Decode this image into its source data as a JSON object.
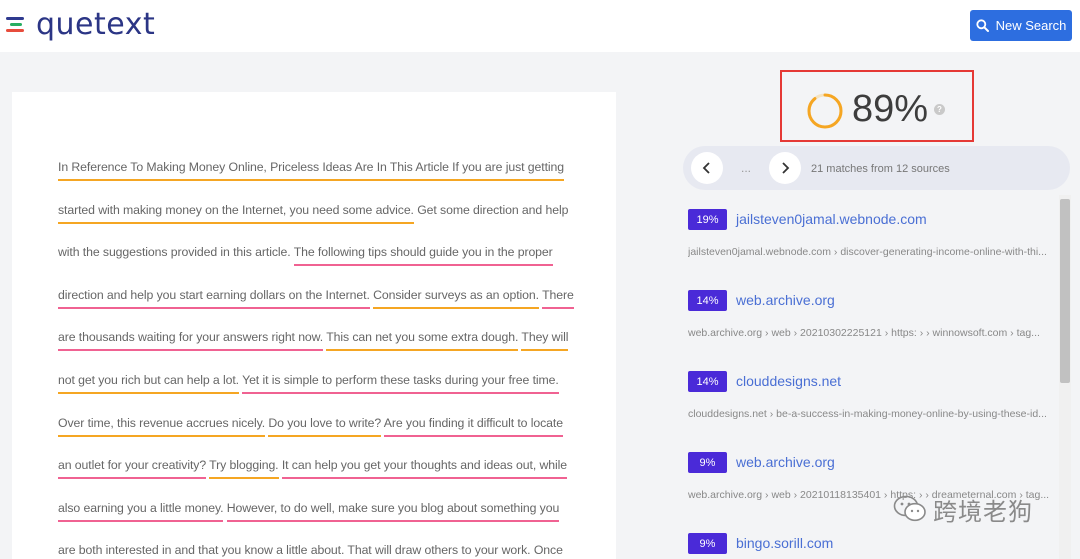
{
  "app": {
    "logo_text": "quetext"
  },
  "header": {
    "new_search_label": "New Search"
  },
  "score": {
    "percent_label": "89%",
    "percent_value": 89,
    "help": "?"
  },
  "pager": {
    "ellipsis": "...",
    "summary": "21 matches from 12 sources"
  },
  "document": {
    "segments": [
      {
        "text": "In Reference To Making Money Online, Priceless Ideas Are In This Article If you are just getting started with making money on the Internet, you need some advice.",
        "highlight": "orange"
      },
      {
        "text": " Get some direction and help with the suggestions provided in this article. ",
        "highlight": "none"
      },
      {
        "text": "The following tips should guide you in the proper direction and help you start earning dollars on the Internet.",
        "highlight": "pink"
      },
      {
        "text": " ",
        "highlight": "none"
      },
      {
        "text": "Consider surveys as an option.",
        "highlight": "orange"
      },
      {
        "text": " ",
        "highlight": "none"
      },
      {
        "text": "There are thousands waiting for your answers right now.",
        "highlight": "pink"
      },
      {
        "text": " ",
        "highlight": "none"
      },
      {
        "text": "This can net you some extra dough.",
        "highlight": "orange"
      },
      {
        "text": " ",
        "highlight": "none"
      },
      {
        "text": "They will not get you rich but can help a lot.",
        "highlight": "orange"
      },
      {
        "text": " ",
        "highlight": "none"
      },
      {
        "text": "Yet it is simple to perform these tasks during your free time.",
        "highlight": "pink"
      },
      {
        "text": " ",
        "highlight": "none"
      },
      {
        "text": "Over time, this revenue accrues nicely.",
        "highlight": "orange"
      },
      {
        "text": " ",
        "highlight": "none"
      },
      {
        "text": "Do you love to write?",
        "highlight": "orange"
      },
      {
        "text": " ",
        "highlight": "none"
      },
      {
        "text": "Are you finding it difficult to locate an outlet for your creativity?",
        "highlight": "pink"
      },
      {
        "text": " ",
        "highlight": "none"
      },
      {
        "text": "Try blogging.",
        "highlight": "orange"
      },
      {
        "text": " ",
        "highlight": "none"
      },
      {
        "text": "It can help you get your thoughts and ideas out, while also earning you a little money.",
        "highlight": "pink"
      },
      {
        "text": " ",
        "highlight": "none"
      },
      {
        "text": "However, to do well, make sure you blog about something you are both interested in and that you know a little about.",
        "highlight": "pink"
      },
      {
        "text": " ",
        "highlight": "none"
      },
      {
        "text": "That will draw others to your work.",
        "highlight": "pink"
      },
      {
        "text": " Once",
        "highlight": "none"
      }
    ]
  },
  "results": [
    {
      "percent": "19%",
      "domain": "jailsteven0jamal.webnode.com",
      "path": "jailsteven0jamal.webnode.com › discover-generating-income-online-with-thi..."
    },
    {
      "percent": "14%",
      "domain": "web.archive.org",
      "path": "web.archive.org › web › 20210302225121 › https: ›  › winnowsoft.com › tag..."
    },
    {
      "percent": "14%",
      "domain": "clouddesigns.net",
      "path": "clouddesigns.net › be-a-success-in-making-money-online-by-using-these-id..."
    },
    {
      "percent": "9%",
      "domain": "web.archive.org",
      "path": "web.archive.org › web › 20210118135401 › https: ›  › dreameternal.com › tag..."
    },
    {
      "percent": "9%",
      "domain": "bingo.sorill.com",
      "path": ""
    }
  ],
  "watermark": {
    "text": "跨境老狗"
  },
  "colors": {
    "accent": "#2d6ee0",
    "badge": "#4a2ad8",
    "highlight_orange": "#f5a623",
    "highlight_pink": "#f06292",
    "ring": "#f5a623",
    "box": "#e53935"
  }
}
